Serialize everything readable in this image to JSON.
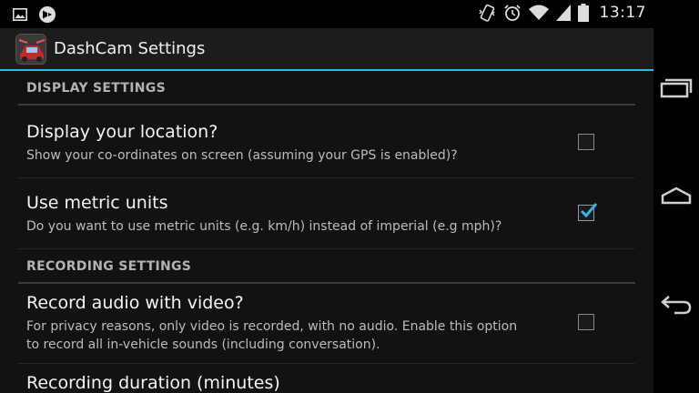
{
  "status_bar": {
    "time": "13:17",
    "icons": [
      "image-notification-icon",
      "media-notification-icon",
      "vibrate-icon",
      "alarm-icon",
      "wifi-icon",
      "signal-icon",
      "battery-icon"
    ]
  },
  "action_bar": {
    "title": "DashCam Settings",
    "accent_color": "#33b5e5"
  },
  "categories": {
    "display": "DISPLAY SETTINGS",
    "recording": "RECORDING SETTINGS"
  },
  "prefs": {
    "location": {
      "title": "Display your location?",
      "summary": "Show your co-ordinates on screen (assuming your GPS is enabled)?",
      "checked": false
    },
    "metric": {
      "title": "Use metric units",
      "summary": "Do you want to use metric units (e.g. km/h) instead of imperial (e.g mph)?",
      "checked": true
    },
    "audio": {
      "title": "Record audio with video?",
      "summary": "For privacy reasons, only video is recorded, with no audio. Enable this option to record all in-vehicle sounds (including conversation).",
      "checked": false
    },
    "duration": {
      "title": "Recording duration (minutes)"
    }
  },
  "nav_bar": {
    "buttons": [
      "recents-icon",
      "home-icon",
      "back-icon"
    ]
  }
}
